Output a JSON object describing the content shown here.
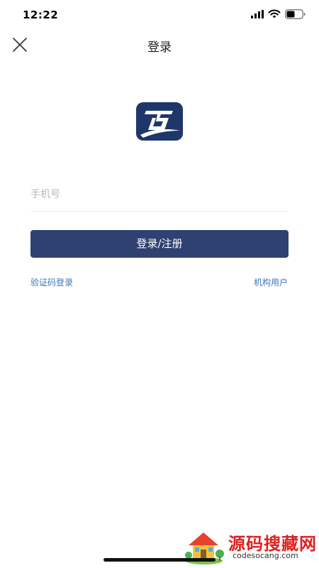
{
  "status_bar": {
    "time": "12:22"
  },
  "nav": {
    "title": "登录"
  },
  "form": {
    "phone_placeholder": "手机号",
    "phone_value": "",
    "submit_label": "登录/注册"
  },
  "links": {
    "sms_login": "验证码登录",
    "org_user": "机构用户"
  },
  "watermark": {
    "title": "源码搜藏网",
    "url": "codesocang.com"
  },
  "colors": {
    "primary": "#2f4170",
    "link": "#3c77b5",
    "logo_bg": "#1e3768",
    "watermark": "#e02020"
  },
  "icons": {
    "close": "close-icon",
    "signal": "signal-icon",
    "wifi": "wifi-icon",
    "battery": "battery-icon",
    "logo": "app-logo"
  }
}
